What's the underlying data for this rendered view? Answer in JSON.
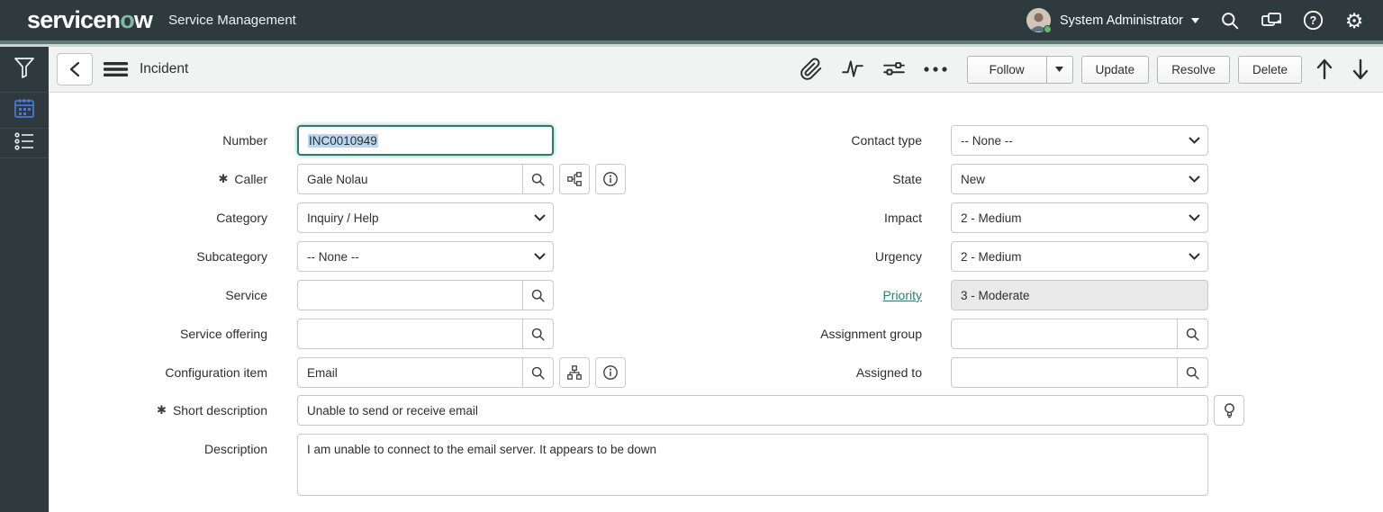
{
  "header": {
    "logo_prefix": "servicen",
    "logo_o": "o",
    "logo_suffix": "w",
    "product": "Service Management",
    "user_name": "System Administrator",
    "colors": {
      "header_bg": "#2e3a3d",
      "brand_green": "#7fb8a4",
      "banner_strip_green": "#5f7975"
    }
  },
  "toolbar": {
    "title": "Incident",
    "follow": "Follow",
    "update": "Update",
    "resolve": "Resolve",
    "delete": "Delete",
    "icons": [
      "attachment-icon",
      "activity-stream-icon",
      "personalize-form-icon",
      "more-options-icon",
      "previous-record-icon",
      "next-record-icon"
    ]
  },
  "sidebar": {
    "icons": [
      "filter-icon",
      "calendar-icon",
      "checklist-icon"
    ]
  },
  "form": {
    "required_marker": "✱",
    "fields": {
      "number": {
        "label": "Number",
        "value": "INC0010949"
      },
      "caller": {
        "label": "Caller",
        "value": "Gale Nolau",
        "required": true
      },
      "category": {
        "label": "Category",
        "value": "Inquiry / Help"
      },
      "subcategory": {
        "label": "Subcategory",
        "value": "-- None --"
      },
      "service": {
        "label": "Service",
        "value": ""
      },
      "service_offering": {
        "label": "Service offering",
        "value": ""
      },
      "configuration_item": {
        "label": "Configuration item",
        "value": "Email"
      },
      "short_description": {
        "label": "Short description",
        "value": "Unable to send or receive email",
        "required": true
      },
      "description": {
        "label": "Description",
        "value": "I am unable to connect to the email server. It appears to be down"
      },
      "contact_type": {
        "label": "Contact type",
        "value": "-- None --"
      },
      "state": {
        "label": "State",
        "value": "New"
      },
      "impact": {
        "label": "Impact",
        "value": "2 - Medium"
      },
      "urgency": {
        "label": "Urgency",
        "value": "2 - Medium"
      },
      "priority": {
        "label": "Priority",
        "value": "3 - Moderate",
        "readonly": true
      },
      "assignment_group": {
        "label": "Assignment group",
        "value": ""
      },
      "assigned_to": {
        "label": "Assigned to",
        "value": ""
      }
    },
    "accent_colors": {
      "focus_green": "#2a7d6d",
      "selection_blue": "#b8d7f3",
      "link_teal": "#2c7f70"
    }
  }
}
